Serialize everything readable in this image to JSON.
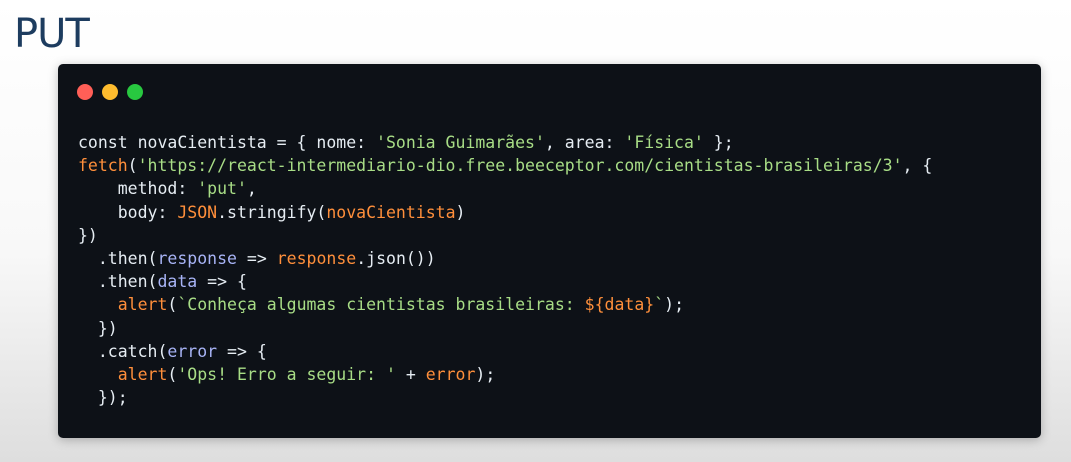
{
  "slide": {
    "title": "PUT"
  },
  "window": {
    "controls": [
      {
        "name": "close-dot",
        "color": "#ff5f57"
      },
      {
        "name": "minimize-dot",
        "color": "#febc2e"
      },
      {
        "name": "maximize-dot",
        "color": "#28c840"
      }
    ]
  },
  "colors": {
    "plain": "#e6edf3",
    "string": "#a8dd86",
    "identifier": "#ff8f3b",
    "parameter": "#a8b4f6"
  },
  "code_lines": [
    [
      {
        "t": "const novaCientista = { nome: ",
        "c": "plain"
      },
      {
        "t": "'Sonia Guimarães'",
        "c": "str"
      },
      {
        "t": ", area: ",
        "c": "plain"
      },
      {
        "t": "'Física'",
        "c": "str"
      },
      {
        "t": " };",
        "c": "plain"
      }
    ],
    [
      {
        "t": "fetch",
        "c": "ident"
      },
      {
        "t": "(",
        "c": "plain"
      },
      {
        "t": "'https://react-intermediario-dio.free.beeceptor.com/cientistas-brasileiras/3'",
        "c": "str"
      },
      {
        "t": ", {",
        "c": "plain"
      }
    ],
    [
      {
        "t": "    method: ",
        "c": "plain"
      },
      {
        "t": "'put'",
        "c": "str"
      },
      {
        "t": ",",
        "c": "plain"
      }
    ],
    [
      {
        "t": "    body: ",
        "c": "plain"
      },
      {
        "t": "JSON",
        "c": "ident"
      },
      {
        "t": ".stringify(",
        "c": "plain"
      },
      {
        "t": "novaCientista",
        "c": "ident"
      },
      {
        "t": ")",
        "c": "plain"
      }
    ],
    [
      {
        "t": "})",
        "c": "plain"
      }
    ],
    [
      {
        "t": "  .then(",
        "c": "plain"
      },
      {
        "t": "response",
        "c": "param"
      },
      {
        "t": " => ",
        "c": "plain"
      },
      {
        "t": "response",
        "c": "ident"
      },
      {
        "t": ".json())",
        "c": "plain"
      }
    ],
    [
      {
        "t": "  .then(",
        "c": "plain"
      },
      {
        "t": "data",
        "c": "param"
      },
      {
        "t": " => {",
        "c": "plain"
      }
    ],
    [
      {
        "t": "    ",
        "c": "plain"
      },
      {
        "t": "alert",
        "c": "ident"
      },
      {
        "t": "(",
        "c": "plain"
      },
      {
        "t": "`Conheça algumas cientistas brasileiras: ",
        "c": "str"
      },
      {
        "t": "${",
        "c": "ident"
      },
      {
        "t": "data",
        "c": "ident"
      },
      {
        "t": "}",
        "c": "ident"
      },
      {
        "t": "`",
        "c": "str"
      },
      {
        "t": ");",
        "c": "plain"
      }
    ],
    [
      {
        "t": "  })",
        "c": "plain"
      }
    ],
    [
      {
        "t": "  .catch(",
        "c": "plain"
      },
      {
        "t": "error",
        "c": "param"
      },
      {
        "t": " => {",
        "c": "plain"
      }
    ],
    [
      {
        "t": "    ",
        "c": "plain"
      },
      {
        "t": "alert",
        "c": "ident"
      },
      {
        "t": "(",
        "c": "plain"
      },
      {
        "t": "'Ops! Erro a seguir: '",
        "c": "str"
      },
      {
        "t": " + ",
        "c": "plain"
      },
      {
        "t": "error",
        "c": "ident"
      },
      {
        "t": ");",
        "c": "plain"
      }
    ],
    [
      {
        "t": "  });",
        "c": "plain"
      }
    ]
  ]
}
